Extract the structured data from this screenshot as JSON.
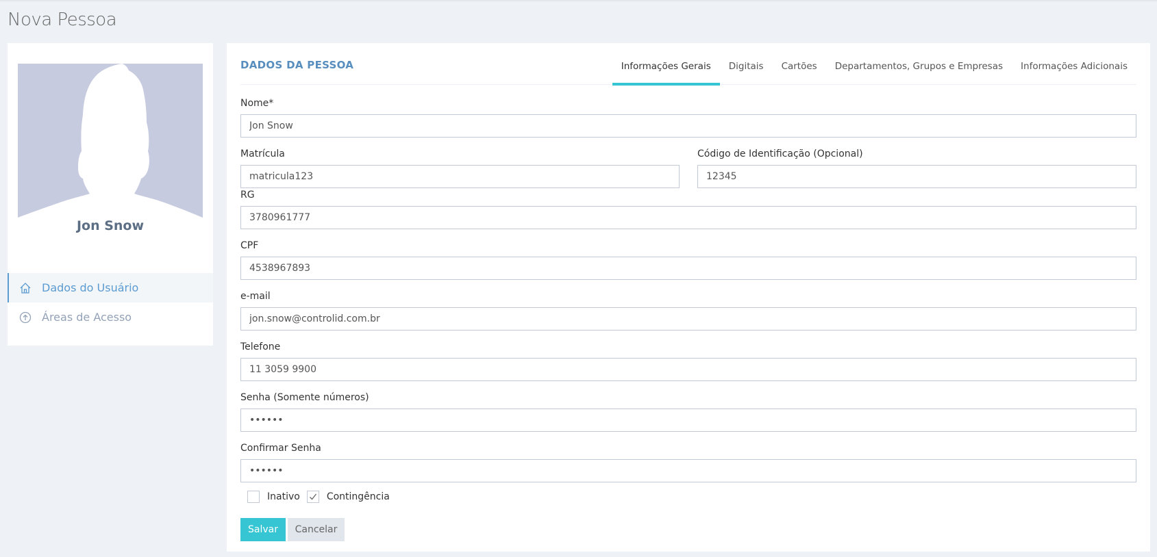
{
  "page": {
    "title": "Nova Pessoa"
  },
  "profile": {
    "name": "Jon Snow",
    "nav": [
      {
        "label": "Dados do Usuário",
        "icon": "home-icon",
        "active": true
      },
      {
        "label": "Áreas de Acesso",
        "icon": "arrow-up-circle-icon",
        "active": false
      }
    ]
  },
  "card": {
    "caption": "DADOS DA PESSOA",
    "tabs": [
      {
        "label": "Informações Gerais",
        "active": true
      },
      {
        "label": "Digitais",
        "active": false
      },
      {
        "label": "Cartões",
        "active": false
      },
      {
        "label": "Departamentos, Grupos e Empresas",
        "active": false
      },
      {
        "label": "Informações Adicionais",
        "active": false
      }
    ]
  },
  "form": {
    "nome": {
      "label": "Nome*",
      "value": "Jon Snow"
    },
    "matricula": {
      "label": "Matrícula",
      "value": "matricula123"
    },
    "codigo": {
      "label": "Código de Identificação (Opcional)",
      "value": "12345"
    },
    "rg": {
      "label": "RG",
      "value": "3780961777"
    },
    "cpf": {
      "label": "CPF",
      "value": "4538967893"
    },
    "email": {
      "label": "e-mail",
      "value": "jon.snow@controlid.com.br"
    },
    "telefone": {
      "label": "Telefone",
      "value": "11 3059 9900"
    },
    "senha": {
      "label": "Senha (Somente números)",
      "value": "••••••"
    },
    "confirmar": {
      "label": "Confirmar Senha",
      "value": "••••••"
    },
    "inativo": {
      "label": "Inativo",
      "checked": false
    },
    "contingencia": {
      "label": "Contingência",
      "checked": true
    }
  },
  "buttons": {
    "save": "Salvar",
    "cancel": "Cancelar"
  },
  "colors": {
    "accent": "#36c6d3",
    "caption": "#578ebe",
    "avatar_bg": "#c7cbe0"
  }
}
